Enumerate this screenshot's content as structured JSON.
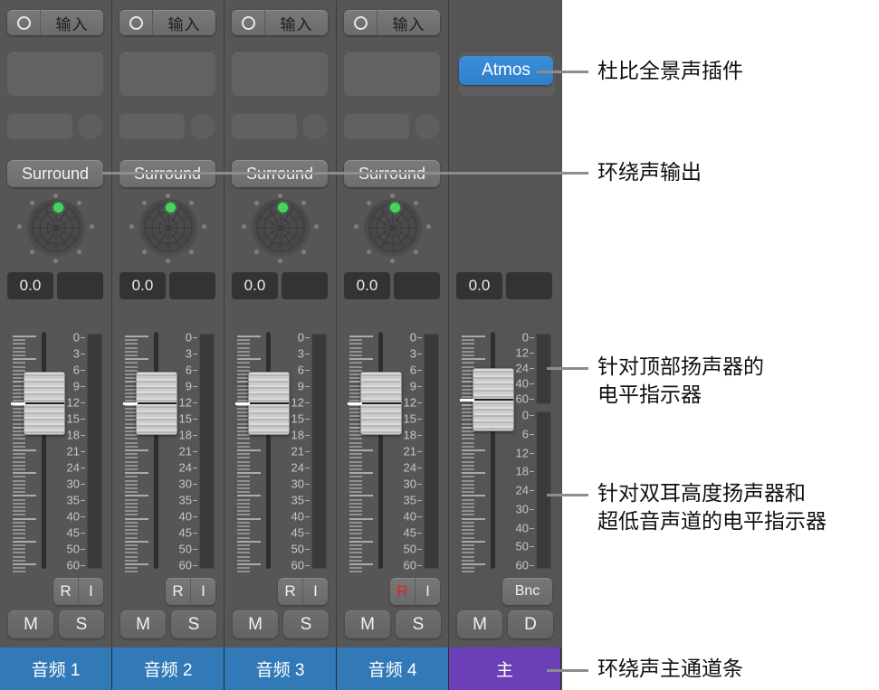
{
  "app": {
    "panel_name": "surround-mixer"
  },
  "scales": {
    "channel_ticks": [
      "0",
      "3",
      "6",
      "9",
      "12",
      "15",
      "18",
      "21",
      "24",
      "30",
      "35",
      "40",
      "45",
      "50",
      "60"
    ],
    "master_top_ticks": [
      "0",
      "12",
      "24",
      "40",
      "60"
    ],
    "master_bottom_ticks": [
      "0",
      "6",
      "12",
      "18",
      "24",
      "30",
      "40",
      "50",
      "60"
    ]
  },
  "channels": [
    {
      "name": "音频 1",
      "name_color": "#3279b7",
      "input_label": "输入",
      "output_label": "Surround",
      "pan_value": "0.0",
      "pan_value_secondary": "",
      "rec_label": "R",
      "input_monitor_label": "I",
      "rec_armed": false,
      "mute_label": "M",
      "solo_label": "S"
    },
    {
      "name": "音频 2",
      "name_color": "#3279b7",
      "input_label": "输入",
      "output_label": "Surround",
      "pan_value": "0.0",
      "pan_value_secondary": "",
      "rec_label": "R",
      "input_monitor_label": "I",
      "rec_armed": false,
      "mute_label": "M",
      "solo_label": "S"
    },
    {
      "name": "音频 3",
      "name_color": "#3279b7",
      "input_label": "输入",
      "output_label": "Surround",
      "pan_value": "0.0",
      "pan_value_secondary": "",
      "rec_label": "R",
      "input_monitor_label": "I",
      "rec_armed": false,
      "mute_label": "M",
      "solo_label": "S"
    },
    {
      "name": "音频 4",
      "name_color": "#3279b7",
      "input_label": "输入",
      "output_label": "Surround",
      "pan_value": "0.0",
      "pan_value_secondary": "",
      "rec_label": "R",
      "input_monitor_label": "I",
      "rec_armed": true,
      "mute_label": "M",
      "solo_label": "S"
    }
  ],
  "master": {
    "name": "主",
    "name_color": "#6b3fb5",
    "plugin_label": "Atmos",
    "plugin_color": "#2f7fc9",
    "pan_value": "0.0",
    "pan_value_secondary": "",
    "bounce_label": "Bnc",
    "mute_label": "M",
    "dim_label": "D"
  },
  "annotations": [
    {
      "text": "杜比全景声插件"
    },
    {
      "text": "环绕声输出"
    },
    {
      "text": "针对顶部扬声器的\n电平指示器"
    },
    {
      "text": "针对双耳高度扬声器和\n超低音声道的电平指示器"
    },
    {
      "text": "环绕声主通道条"
    }
  ]
}
